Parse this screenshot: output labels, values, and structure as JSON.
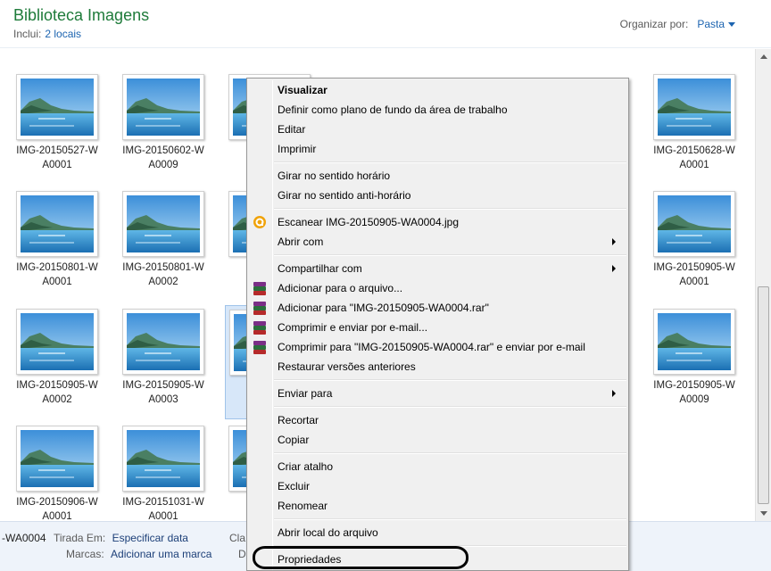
{
  "header": {
    "title": "Biblioteca Imagens",
    "includes_label": "Inclui:",
    "includes_link": "2 locais",
    "arrange_label": "Organizar por:",
    "arrange_value": "Pasta"
  },
  "tiles": [
    {
      "line1": "IMG-20150527-W",
      "line2": "A0001"
    },
    {
      "line1": "IMG-20150602-W",
      "line2": "A0009"
    },
    {
      "line1": "IMG",
      "line2": ""
    },
    {
      "line1": "IMG-20150628-W",
      "line2": "A0001"
    },
    {
      "line1": "IMG-20150801-W",
      "line2": "A0001"
    },
    {
      "line1": "IMG-20150801-W",
      "line2": "A0002"
    },
    {
      "line1": "IMG",
      "line2": ""
    },
    {
      "line1": "IMG-20150905-W",
      "line2": "A0001"
    },
    {
      "line1": "IMG-20150905-W",
      "line2": "A0002"
    },
    {
      "line1": "IMG-20150905-W",
      "line2": "A0003"
    },
    {
      "line1": "IMG",
      "line2": ""
    },
    {
      "line1": "IMG-20150905-W",
      "line2": "A0009"
    },
    {
      "line1": "IMG-20150906-W",
      "line2": "A0001"
    },
    {
      "line1": "IMG-20151031-W",
      "line2": "A0001"
    },
    {
      "line1": "IMG",
      "line2": ""
    }
  ],
  "details": {
    "filename_fragment": "-WA0004",
    "taken_label": "Tirada Em:",
    "taken_value": "Especificar data",
    "tags_label": "Marcas:",
    "tags_value": "Adicionar uma marca",
    "frag_cla": "Cla",
    "frag_d": "D"
  },
  "context_menu": {
    "items": [
      {
        "label": "Visualizar"
      },
      {
        "label": "Definir como plano de fundo da área de trabalho"
      },
      {
        "label": "Editar"
      },
      {
        "label": "Imprimir"
      },
      {
        "label": "Girar no sentido horário"
      },
      {
        "label": "Girar no sentido anti-horário"
      },
      {
        "label": "Escanear IMG-20150905-WA0004.jpg"
      },
      {
        "label": "Abrir com"
      },
      {
        "label": "Compartilhar com"
      },
      {
        "label": "Adicionar para o arquivo..."
      },
      {
        "label": "Adicionar para \"IMG-20150905-WA0004.rar\""
      },
      {
        "label": "Comprimir e enviar por e-mail..."
      },
      {
        "label": "Comprimir para \"IMG-20150905-WA0004.rar\" e enviar por e-mail"
      },
      {
        "label": "Restaurar versões anteriores"
      },
      {
        "label": "Enviar para"
      },
      {
        "label": "Recortar"
      },
      {
        "label": "Copiar"
      },
      {
        "label": "Criar atalho"
      },
      {
        "label": "Excluir"
      },
      {
        "label": "Renomear"
      },
      {
        "label": "Abrir local do arquivo"
      },
      {
        "label": "Propriedades"
      }
    ]
  },
  "colors": {
    "title_green": "#1e7b3a",
    "link_blue": "#1c64b0",
    "selection": "#d7e7f9",
    "menu_bg": "#f0f0f0",
    "scan_icon": "#f0a30a"
  }
}
